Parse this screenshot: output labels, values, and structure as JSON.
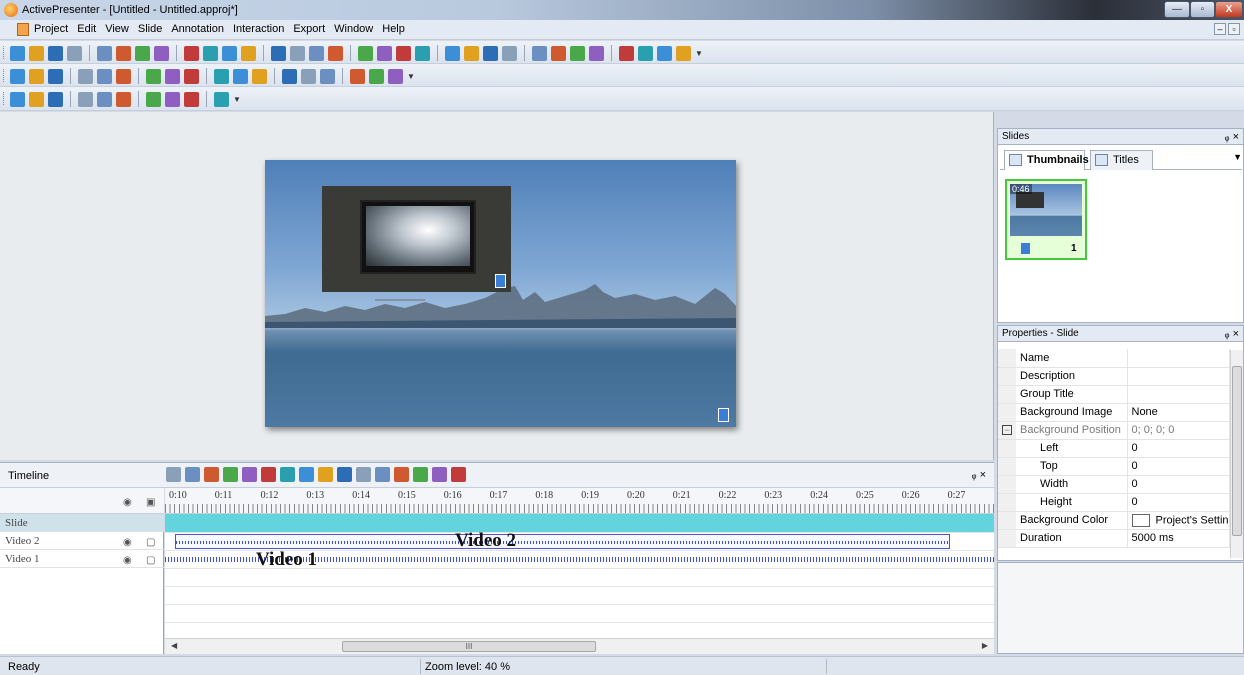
{
  "window": {
    "title": "ActivePresenter - [Untitled - Untitled.approj*]",
    "min_label": "—",
    "max_label": "▫",
    "close_label": "X"
  },
  "menu": {
    "items": [
      "Project",
      "Edit",
      "View",
      "Slide",
      "Annotation",
      "Interaction",
      "Export",
      "Window",
      "Help"
    ]
  },
  "toolbar_icons": {
    "row1": [
      "new-project-icon",
      "open-icon",
      "save-icon",
      "cut-icon",
      "copy-icon",
      "paste-icon",
      "delete-icon",
      "undo-icon",
      "redo-icon",
      "find-icon",
      "record-icon",
      "zoom-icon",
      "insert-slide-icon",
      "duplicate-slide-icon",
      "open-folder-icon",
      "shape-icon",
      "text-caption-icon",
      "image-icon",
      "highlight-icon",
      "help-icon",
      "settings-icon",
      "fullscreen-icon",
      "closed-caption-icon",
      "gesture-icon",
      "text-icon",
      "note-icon",
      "video-icon",
      "audio-icon",
      "zoom-n-pan-icon",
      "spotlight-icon",
      "cursor-icon",
      "film-icon"
    ],
    "row2": [
      "align-left-icon",
      "align-center-icon",
      "align-right-icon",
      "align-top-icon",
      "align-middle-icon",
      "align-bottom-icon",
      "distribute-h-icon",
      "distribute-v-icon",
      "same-width-icon",
      "same-height-icon",
      "group-icon",
      "ungroup-icon",
      "bring-front-icon",
      "send-back-icon",
      "bring-forward-icon",
      "send-backward-icon",
      "arrange-icon",
      "properties-icon"
    ],
    "row3": [
      "slide-properties-icon",
      "export-video-icon",
      "export-flash-icon",
      "export-html-icon",
      "export-pdf-icon",
      "export-word-icon",
      "export-excel-icon",
      "export-ppt-icon",
      "web-icon",
      "help-circle-icon"
    ]
  },
  "slides_panel": {
    "header": "Slides",
    "pin": "ᵩ ×",
    "tabs": [
      {
        "label": "Thumbnails"
      },
      {
        "label": "Titles"
      }
    ],
    "thumbnail": {
      "duration": "0:46",
      "number": "1"
    }
  },
  "properties_panel": {
    "header": "Properties - Slide",
    "pin": "ᵩ ×",
    "rows": [
      {
        "name": "Name",
        "value": ""
      },
      {
        "name": "Description",
        "value": ""
      },
      {
        "name": "Group Title",
        "value": ""
      },
      {
        "name": "Background Image",
        "value": "None"
      },
      {
        "name": "Background Position",
        "value": "0; 0; 0; 0"
      },
      {
        "name": "Left",
        "value": "0"
      },
      {
        "name": "Top",
        "value": "0"
      },
      {
        "name": "Width",
        "value": "0"
      },
      {
        "name": "Height",
        "value": "0"
      },
      {
        "name": "Background Color",
        "value": "Project's Settin"
      },
      {
        "name": "Duration",
        "value": "5000 ms"
      }
    ]
  },
  "timeline": {
    "title": "Timeline",
    "pin": "ᵩ ×",
    "ruler_ticks": [
      "0:10",
      "0:11",
      "0:12",
      "0:13",
      "0:14",
      "0:15",
      "0:16",
      "0:17",
      "0:18",
      "0:19",
      "0:20",
      "0:21",
      "0:22",
      "0:23",
      "0:24",
      "0:25",
      "0:26",
      "0:27"
    ],
    "tracks": [
      {
        "label": "Slide"
      },
      {
        "label": "Video 2"
      },
      {
        "label": "Video 1"
      }
    ],
    "clips": {
      "video2": "Video 2",
      "video1": "Video 1"
    },
    "scroll_grip": "III"
  },
  "status": {
    "left": "Ready",
    "zoom": "Zoom level: 40 %"
  },
  "colors": {
    "accent": "#43c93b",
    "slide_track": "#63d3dd",
    "clip_border": "#4a57c9"
  }
}
